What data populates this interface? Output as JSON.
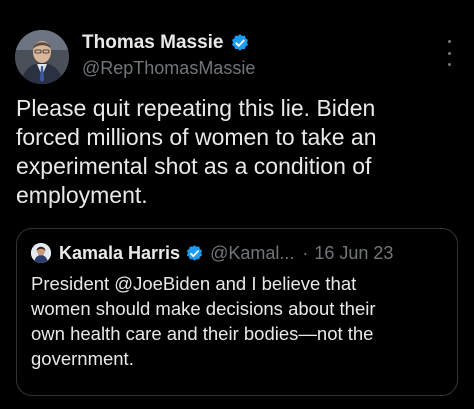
{
  "tweet": {
    "author_name": "Thomas Massie",
    "author_handle": "@RepThomasMassie",
    "text": "Please quit repeating this lie. Biden\nforced millions of women to take an\nexperimental shot as a condition of\nemployment.",
    "verified_icon": "verified-badge-icon",
    "more_icon": "more-options-icon"
  },
  "quoted_tweet": {
    "author_name": "Kamala Harris",
    "author_handle": "@Kamal...",
    "separator": "·",
    "date": "16 Jun 23",
    "text": "President @JoeBiden and I believe that\nwomen should make decisions about their\nown health care and their bodies—not the\ngovernment.",
    "verified_icon": "verified-badge-icon"
  },
  "colors": {
    "background": "#000000",
    "primary_text": "#e7e9ea",
    "secondary_text": "#71767b",
    "verified_blue": "#1d9bf0",
    "quote_border": "#2f3336"
  }
}
